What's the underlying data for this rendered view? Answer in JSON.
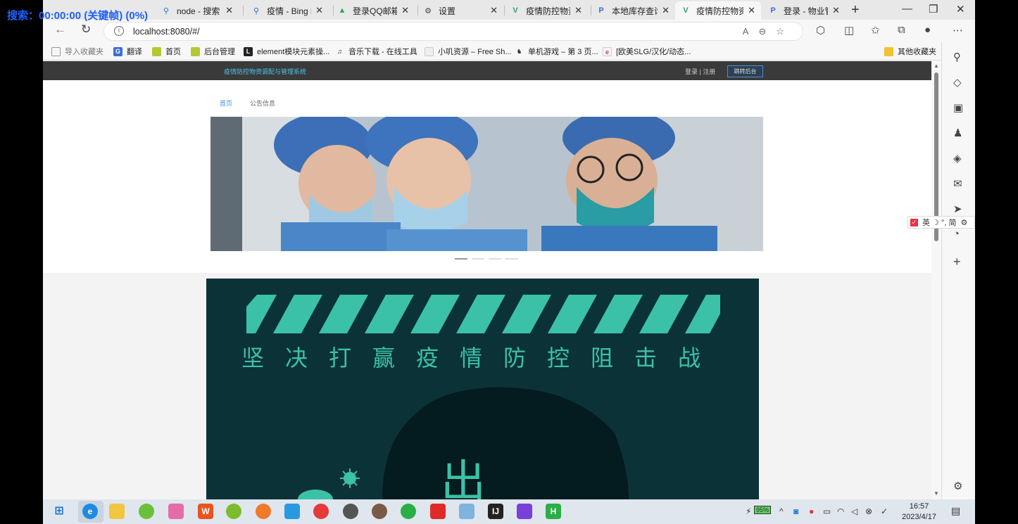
{
  "overlay": {
    "text": "搜索：00:00:00 (关键帧) (0%)"
  },
  "tabs": [
    {
      "label": "node - 搜索",
      "icon": "search-icon"
    },
    {
      "label": "疫情 - Bing im",
      "icon": "search-icon"
    },
    {
      "label": "登录QQ邮箱",
      "icon": "qq-mail-icon"
    },
    {
      "label": "设置",
      "icon": "gear-icon"
    },
    {
      "label": "疫情防控物资",
      "icon": "vue-icon"
    },
    {
      "label": "本地库存查询",
      "icon": "p-icon"
    },
    {
      "label": "疫情防控物资",
      "icon": "vue-icon"
    },
    {
      "label": "登录 - 物业管",
      "icon": "p-icon"
    }
  ],
  "address": {
    "url": "localhost:8080/#/"
  },
  "bookmarks": [
    "导入收藏夹",
    "翻译",
    "首页",
    "后台管理",
    "element模块元素操...",
    "音乐下载 - 在线工具",
    "小叽资源 – Free Sh...",
    "单机游戏 – 第 3 页...",
    "[欧美SLG/汉化/动态...",
    "其他收藏夹"
  ],
  "site": {
    "title": "疫情防控物资调配与管理系统",
    "auth": "登录 | 注册",
    "admin_button": "跳转后台",
    "nav": [
      "首页",
      "公告信息"
    ]
  },
  "poster": {
    "slogan": "坚决打赢疫情防控阻击战",
    "char": "出"
  },
  "ime": {
    "label": "英 ☽ °, 简"
  },
  "clock": {
    "time": "16:57",
    "date": "2023/4/17"
  },
  "battery": "95%",
  "colors": {
    "accent": "#3a8ee6",
    "poster_bg": "#0b3237",
    "poster_text": "#3bc1a7"
  }
}
